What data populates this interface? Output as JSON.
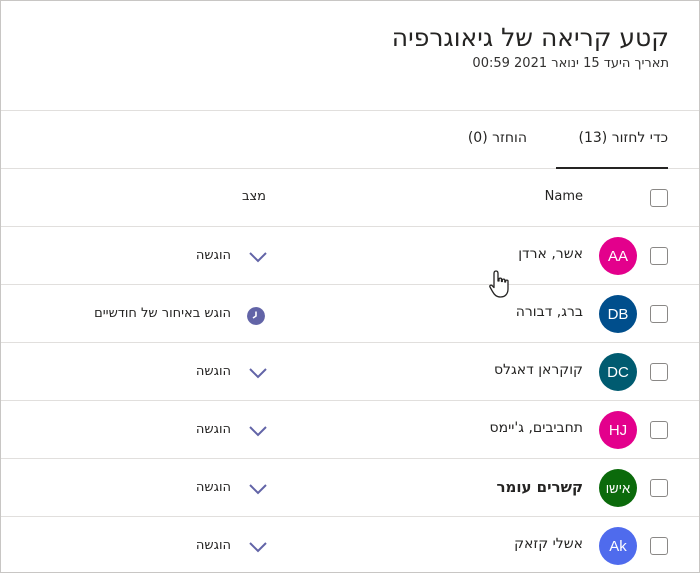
{
  "assignment": {
    "title": "קטע קריאה של גיאוגרפיה",
    "due": "תאריך היעד 15 ינואר 2021 00:59"
  },
  "tabs": [
    {
      "label": "כדי לחזור (13)",
      "active": true
    },
    {
      "label": "הוחזר (0)",
      "active": false
    }
  ],
  "columns": {
    "name": "Name",
    "status": "מצב"
  },
  "students": [
    {
      "initials": "AA",
      "name": "אשר, ארדן",
      "status": "הוגשה",
      "status_icon": "chevron-down-icon",
      "avatar_color": "#e3008c"
    },
    {
      "initials": "DB",
      "name": "ברג, דבורה",
      "status": "הוגש באיחור של חודשיים",
      "status_icon": "late-clock-icon",
      "avatar_color": "#004e8c"
    },
    {
      "initials": "DC",
      "name": "קוקראן דאגלס",
      "status": "הוגשה",
      "status_icon": "chevron-down-icon",
      "avatar_color": "#005b70"
    },
    {
      "initials": "HJ",
      "name": "תחביבים, ג'יימס",
      "status": "הוגשה",
      "status_icon": "chevron-down-icon",
      "avatar_color": "#e3008c"
    },
    {
      "initials": "אישו",
      "name": "קשרים עומר",
      "status": "הוגשה",
      "status_icon": "chevron-down-icon",
      "avatar_color": "#0b6a0b"
    },
    {
      "initials": "Ak",
      "name": "אשלי קזאק",
      "status": "הוגשה",
      "status_icon": "chevron-down-icon",
      "avatar_color": "#4f6bed"
    }
  ],
  "colors": {
    "accent": "#6264a7",
    "divider": "#e1dfdd"
  }
}
